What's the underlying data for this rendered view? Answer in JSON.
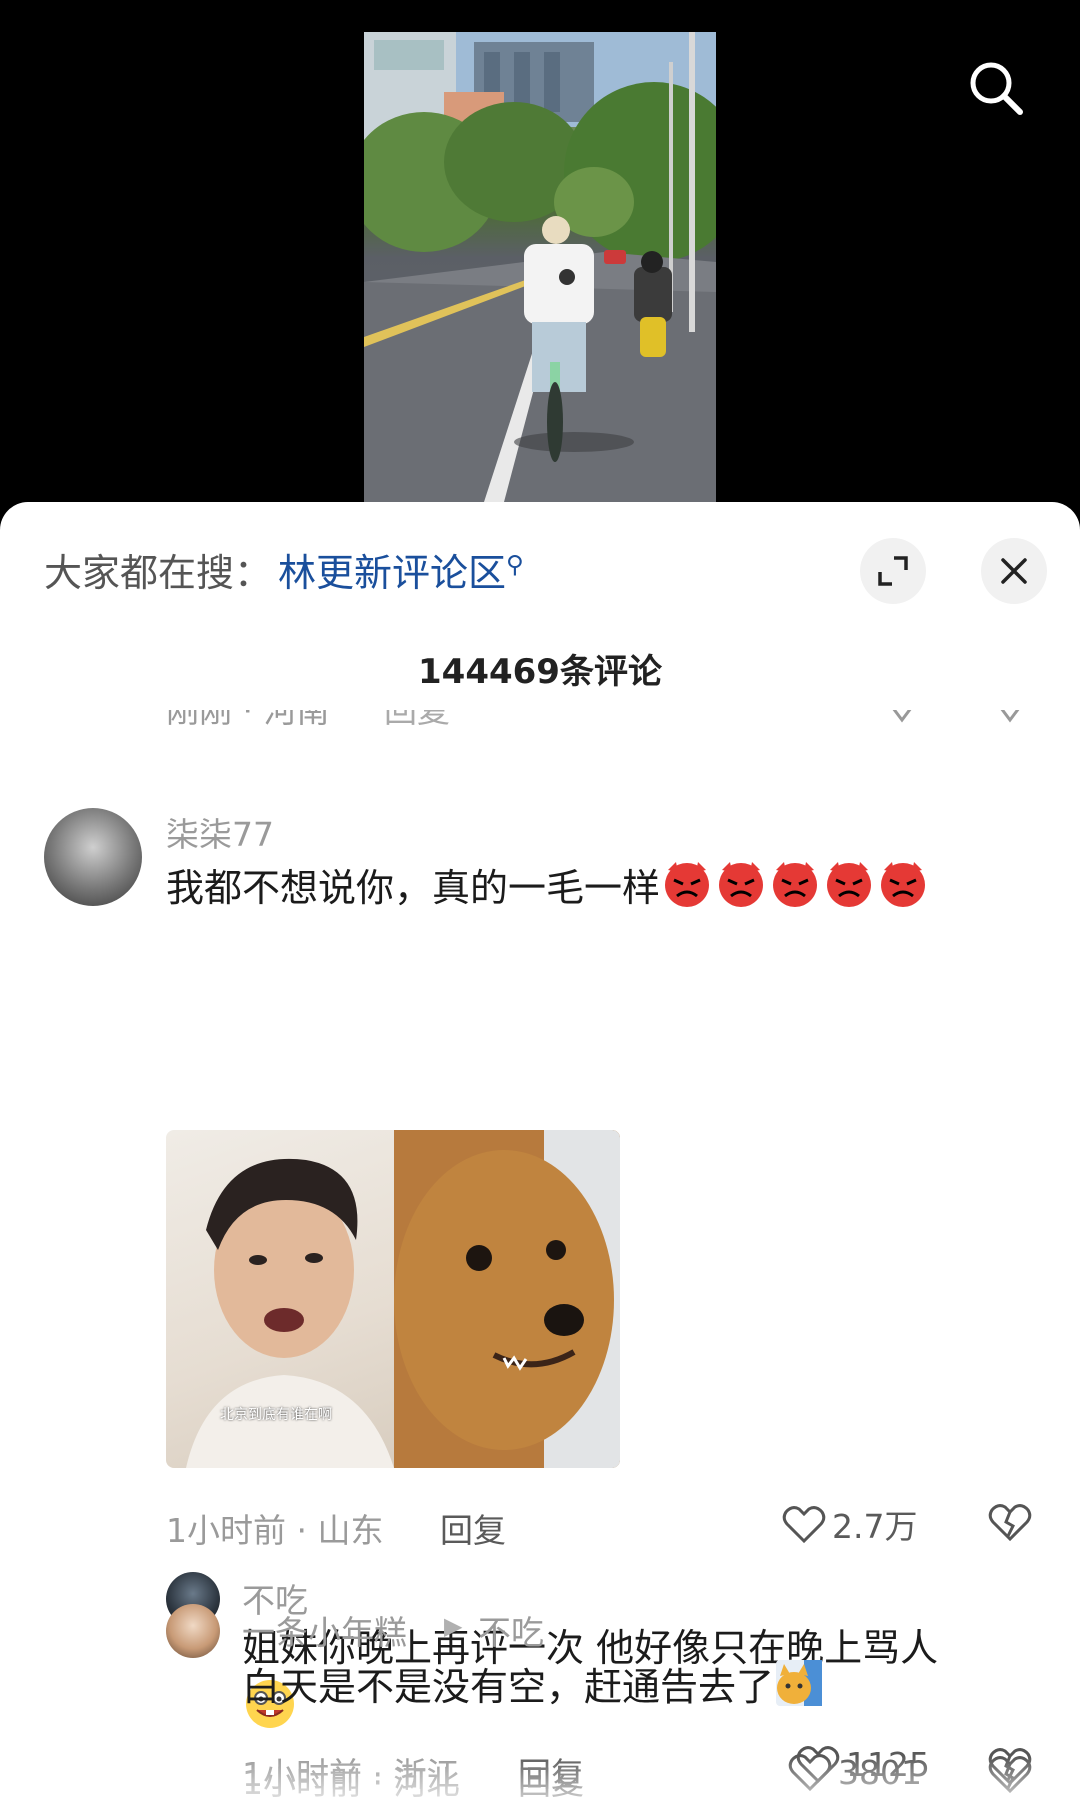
{
  "header": {
    "trending_prefix": "大家都在搜：",
    "trending_query": "林更新评论区",
    "comment_count": "144469条评论"
  },
  "partial_comment": {
    "meta": "刚刚 · 河南",
    "reply_label": "回复"
  },
  "comments": [
    {
      "username": "柒柒77",
      "text": "我都不想说你，真的一毛一样",
      "emoji": [
        "angry-face",
        "angry-face",
        "angry-face",
        "angry-face",
        "angry-face"
      ],
      "meta": "1小时前 · 山东",
      "reply_label": "回复",
      "likes": "2.7万",
      "image_caption": "北京到底有谁在啊"
    },
    {
      "username": "不吃",
      "text": "姐妹你晚上再评一次 他好像只在晚上骂人",
      "emoji": [
        "grinning-face"
      ],
      "meta": "1小时前 · 河北",
      "reply_label": "回复",
      "likes": "3801"
    },
    {
      "username": "一条小年糕",
      "reply_to": "不吃",
      "text": "白天是不是没有空，赶通告去了",
      "emoji": [
        "cat-sticker"
      ],
      "meta": "1小时前 · 浙江",
      "reply_label": "回复",
      "likes": "1125"
    }
  ],
  "colors": {
    "link": "#1a4f9c",
    "meta_gray": "#9a9a9a",
    "text": "#1b1b1b",
    "background_top": "#000000"
  },
  "icons": [
    "search-icon",
    "expand-icon",
    "close-icon",
    "heart-icon",
    "broken-heart-icon"
  ]
}
